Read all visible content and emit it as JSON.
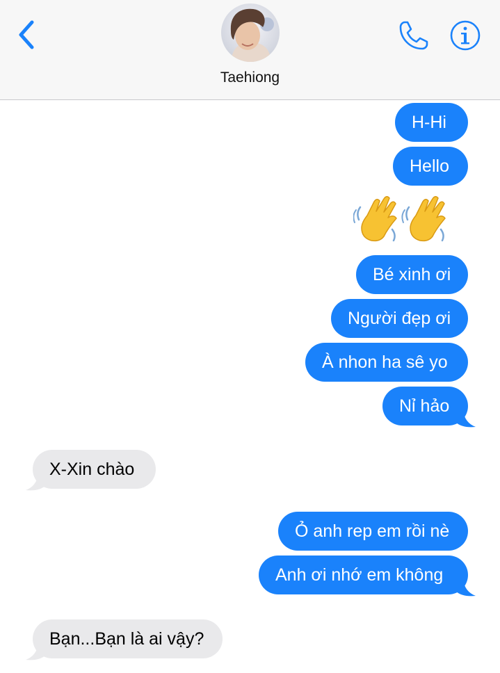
{
  "header": {
    "contact_name": "Taehiong",
    "back_icon": "chevron-left-icon",
    "call_icon": "phone-icon",
    "info_icon": "info-icon",
    "accent_color": "#1a82fb"
  },
  "messages": [
    {
      "direction": "sent",
      "text": "H-Hi"
    },
    {
      "direction": "sent",
      "text": "Hello"
    },
    {
      "direction": "sent",
      "text": "👋👋",
      "kind": "emoji",
      "icon": "waving-hand-icon"
    },
    {
      "direction": "sent",
      "text": "Bé xinh ơi"
    },
    {
      "direction": "sent",
      "text": "Người đẹp ơi"
    },
    {
      "direction": "sent",
      "text": "À nhon ha sê yo"
    },
    {
      "direction": "sent",
      "text": "Nỉ hảo"
    },
    {
      "direction": "received",
      "text": "X-Xin chào"
    },
    {
      "direction": "sent",
      "text": "Ỏ anh rep em rồi nè"
    },
    {
      "direction": "sent",
      "text": "Anh ơi nhớ em không"
    },
    {
      "direction": "received",
      "text": "Bạn...Bạn là ai vậy?"
    }
  ],
  "colors": {
    "sent_bubble": "#1a82fb",
    "received_bubble": "#e9e9eb"
  }
}
